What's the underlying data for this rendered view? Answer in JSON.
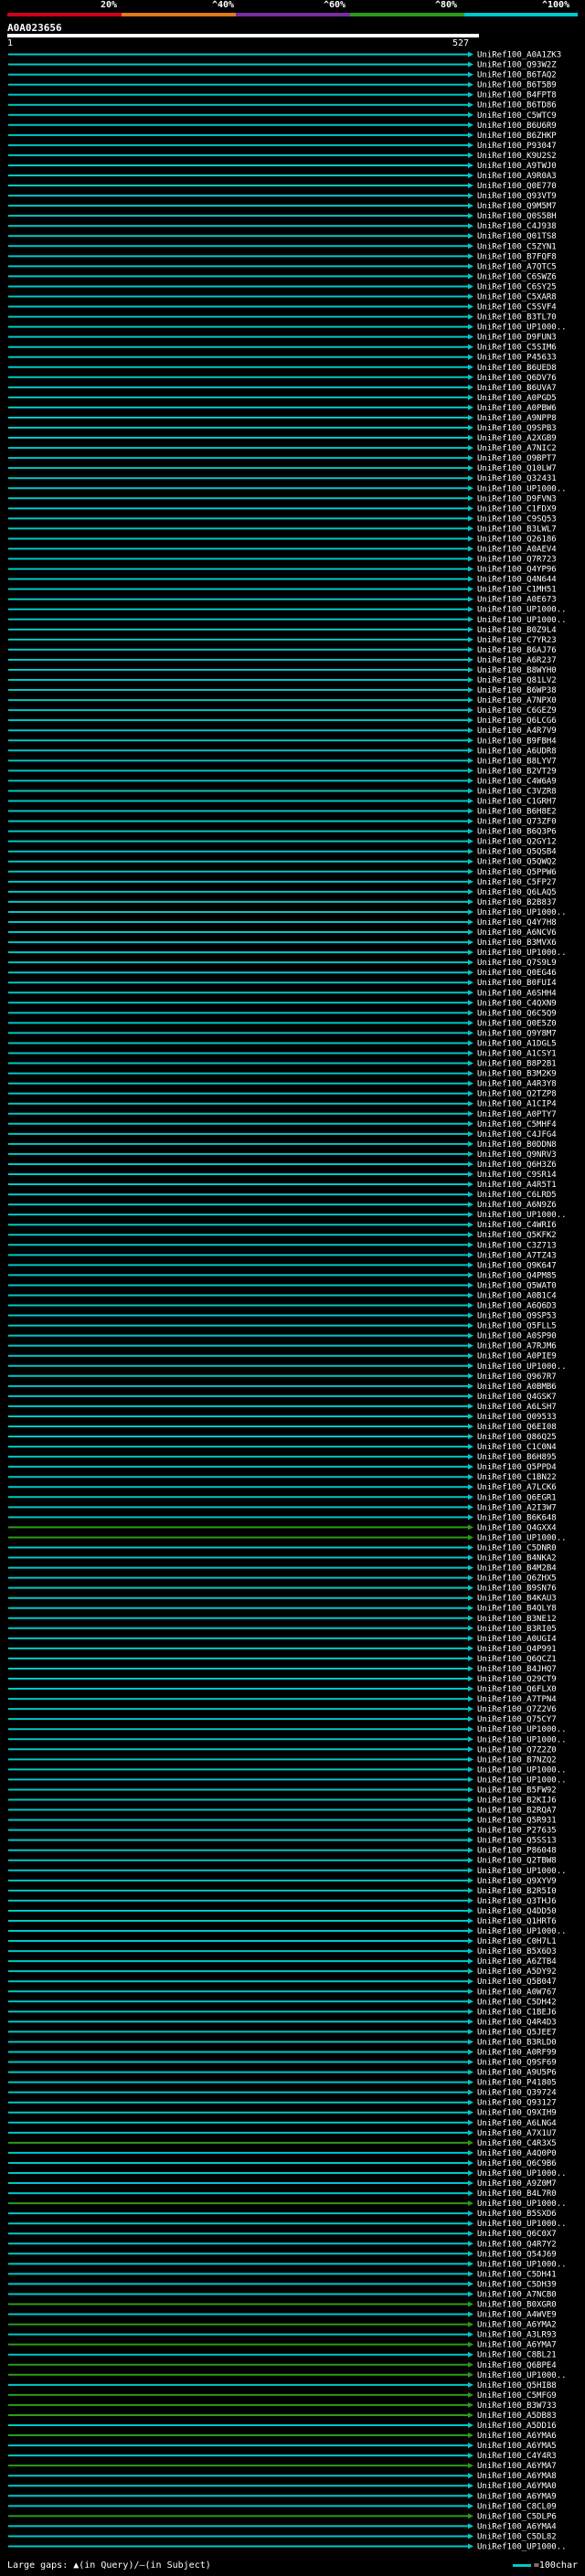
{
  "legend": {
    "labels": [
      "20%",
      "^40%",
      "^60%",
      "^80%",
      "^100%"
    ],
    "colors": [
      "#d0021b",
      "#e07a14",
      "#7a2da0",
      "#2c9b19",
      "#00c8c8"
    ]
  },
  "query": {
    "name": "A0A023656",
    "start": "1",
    "end": "527"
  },
  "footer": {
    "gaps_text": "Large gaps: ▲(in Query)/—(in Subject)",
    "scale_text": "=100char"
  },
  "hits_prefix": "UniRef100_",
  "hit_ids": [
    "A0A1ZK3",
    "Q93W2Z",
    "B6TAQ2",
    "B6T5B9",
    "B4FPT8",
    "B6TD86",
    "C5WTC9",
    "B6U6R9",
    "B6ZHKP",
    "P93047",
    "K9U2S2",
    "A9TWJ0",
    "A9R0A3",
    "Q0E770",
    "Q93VT9",
    "Q9M5M7",
    "Q0S5BH",
    "C4J938",
    "Q01TS8",
    "C5ZYN1",
    "B7FQF8",
    "A7QTC5",
    "C6SWZ6",
    "C6SY25",
    "C5XAR8",
    "C5SVF4",
    "B3TL70",
    "UP1000..",
    "D9FUN3",
    "C5SIM6",
    "P45633",
    "B6UED8",
    "Q6DV76",
    "B6UVA7",
    "A0PGD5",
    "A0PBW6",
    "A9NPP8",
    "Q9SPB3",
    "A2XGB9",
    "A7NIC2",
    "O9BPT7",
    "Q10LW7",
    "Q32431",
    "UP1000..",
    "D9FVN3",
    "C1FDX9",
    "C9SQ53",
    "B3LWL7",
    "Q26186",
    "A0AEV4",
    "Q7R723",
    "Q4YP96",
    "Q4N644",
    "C1MH51",
    "A0E673",
    "UP1000..",
    "UP1000..",
    "B0Z9L4",
    "C7YR23",
    "B6AJ76",
    "A6R237",
    "B8WYH0",
    "Q81LV2",
    "B6WP38",
    "A7NPX0",
    "C6GEZ9",
    "Q6LCG6",
    "A4R7V9",
    "B9FBH4",
    "A6UDR8",
    "B8LYV7",
    "B2VT29",
    "C4W6A9",
    "C3VZR8",
    "C1GRH7",
    "B6H8E2",
    "Q73ZF0",
    "B6Q3P6",
    "Q2GY12",
    "Q5QSB4",
    "Q5QWQ2",
    "Q5PPW6",
    "C5FP27",
    "Q6LAQ5",
    "B2B837",
    "UP1000..",
    "Q4Y7H8",
    "A6NCV6",
    "B3MVX6",
    "UP1000..",
    "Q7S9L9",
    "Q0EG46",
    "B0FUI4",
    "A6SHH4",
    "C4QXN9",
    "Q6C5Q9",
    "Q0E5Z0",
    "Q9Y8M7",
    "A1DGL5",
    "A1CSY1",
    "B8P2B1",
    "B3M2K9",
    "A4R3Y8",
    "Q2TZP8",
    "A1CIP4",
    "A0PTY7",
    "C5MHF4",
    "C4JFG4",
    "B0DDN8",
    "Q9NRV3",
    "Q6H3Z6",
    "C9SR14",
    "A4R5T1",
    "C6LRD5",
    "A6N9Z6",
    "UP1000..",
    "C4WRI6",
    "Q5KFK2",
    "C3Z713",
    "A7TZ43",
    "Q9K647",
    "Q4PM85",
    "Q5WAT0",
    "A0B1C4",
    "A6Q6D3",
    "Q9SP53",
    "Q5FLL5",
    "A0SP90",
    "A7RJM6",
    "A0PIE9",
    "UP1000..",
    "Q967R7",
    "A0BMB6",
    "Q4GSK7",
    "A6LSH7",
    "Q09533",
    "Q6EI08",
    "Q86Q25",
    "C1C0N4",
    "B6H895",
    "Q5PPD4",
    "C1BN22",
    "A7LCK6",
    "Q6EGR1",
    "A2I3W7",
    "B6K648",
    "Q4GXX4",
    "UP1000..",
    "C5DNR0",
    "B4NKA2",
    "B4M2B4",
    "Q6ZHX5",
    "B9SN76",
    "B4KAU3",
    "B4QLY8",
    "B3NE12",
    "B3RI05",
    "A0UGI4",
    "Q4P991",
    "Q6QCZ1",
    "B4JHQ7",
    "Q29CT9",
    "Q6FLX0",
    "A7TPN4",
    "Q7Z2V6",
    "Q75CY7",
    "UP1000..",
    "UP1000..",
    "Q7Z2Z0",
    "B7NZQ2",
    "UP1000..",
    "UP1000..",
    "B5FW92",
    "B2KIJ6",
    "B2RQA7",
    "Q5R931",
    "P27635",
    "Q5SS13",
    "P86048",
    "Q2TBW8",
    "UP1000..",
    "Q9XYV9",
    "B2R5I0",
    "Q3THJ6",
    "Q4DD50",
    "Q1HRT6",
    "UP1000..",
    "C0H7L1",
    "B5X6D3",
    "A6ZTB4",
    "A5DY92",
    "Q5B047",
    "A0W767",
    "C5DH42",
    "C1BEJ6",
    "Q4R4D3",
    "Q5JEE7",
    "B3RLD0",
    "A0RF99",
    "Q9SF69",
    "A9U5P6",
    "P41805",
    "Q39724",
    "Q93127",
    "Q9XIH9",
    "A6LNG4",
    "A7X1U7",
    "C4R3X5",
    "A4Q0P0",
    "Q6C9B6",
    "UP1000..",
    "A9Z0M7",
    "B4L7R0",
    "UP1000..",
    "B5SXD6",
    "UP1000..",
    "Q6C0X7",
    "Q4R7Y2",
    "Q54J69",
    "UP1000..",
    "C5DH41",
    "C5DH39",
    "A7NCB0",
    "B0XGR0",
    "A4WVE9",
    "A6YMA2",
    "A3LR93",
    "A6YMA7",
    "C8BL21",
    "Q6BPE4",
    "UP1000..",
    "Q5HIB8",
    "C5MFG9",
    "B3W733",
    "A5DB83",
    "A5DD16",
    "A6YMA6",
    "A6YMA5",
    "C4Y4R3",
    "A6YMA7",
    "A6YMA8",
    "A6YMA0",
    "A6YMA9",
    "C8CL09",
    "C5DLP6",
    "A6YMA4",
    "C5DL82",
    "UP1000.."
  ],
  "hit_levels": [
    4,
    4,
    4,
    4,
    4,
    4,
    4,
    4,
    4,
    4,
    4,
    4,
    4,
    4,
    4,
    4,
    4,
    4,
    4,
    4,
    4,
    4,
    4,
    4,
    4,
    4,
    4,
    4,
    4,
    4,
    4,
    4,
    4,
    4,
    4,
    4,
    4,
    4,
    4,
    4,
    4,
    4,
    4,
    4,
    4,
    4,
    4,
    4,
    4,
    4,
    4,
    4,
    4,
    4,
    4,
    4,
    4,
    4,
    4,
    4,
    4,
    4,
    4,
    4,
    4,
    4,
    4,
    4,
    4,
    4,
    4,
    4,
    4,
    4,
    4,
    4,
    4,
    4,
    4,
    4,
    4,
    4,
    4,
    4,
    4,
    4,
    4,
    4,
    4,
    4,
    4,
    4,
    4,
    4,
    4,
    4,
    4,
    4,
    4,
    4,
    4,
    4,
    4,
    4,
    4,
    4,
    4,
    4,
    4,
    4,
    4,
    4,
    4,
    4,
    4,
    4,
    4,
    4,
    4,
    4,
    4,
    4,
    4,
    4,
    4,
    4,
    4,
    4,
    4,
    4,
    4,
    4,
    4,
    4,
    4,
    4,
    4,
    4,
    4,
    4,
    4,
    4,
    4,
    4,
    4,
    4,
    3,
    3,
    4,
    4,
    4,
    4,
    4,
    4,
    4,
    4,
    4,
    4,
    4,
    4,
    4,
    4,
    4,
    4,
    4,
    4,
    4,
    4,
    4,
    4,
    4,
    4,
    4,
    4,
    4,
    4,
    4,
    4,
    4,
    4,
    4,
    4,
    4,
    4,
    4,
    4,
    4,
    4,
    4,
    4,
    4,
    4,
    4,
    4,
    4,
    4,
    4,
    4,
    4,
    4,
    4,
    4,
    4,
    4,
    4,
    4,
    4,
    3,
    4,
    4,
    4,
    4,
    4,
    3,
    4,
    4,
    4,
    4,
    4,
    4,
    4,
    4,
    4,
    3,
    4,
    3,
    4,
    3,
    4,
    3,
    3,
    4,
    3,
    3,
    3,
    4,
    3,
    4,
    4,
    3,
    4,
    4,
    4,
    4,
    3,
    4,
    4,
    4,
    4,
    4,
    4,
    4,
    4,
    4,
    4,
    4,
    4,
    4,
    3,
    4,
    4,
    4,
    4,
    4,
    4,
    4,
    4,
    3,
    4,
    4,
    4,
    4,
    4
  ]
}
